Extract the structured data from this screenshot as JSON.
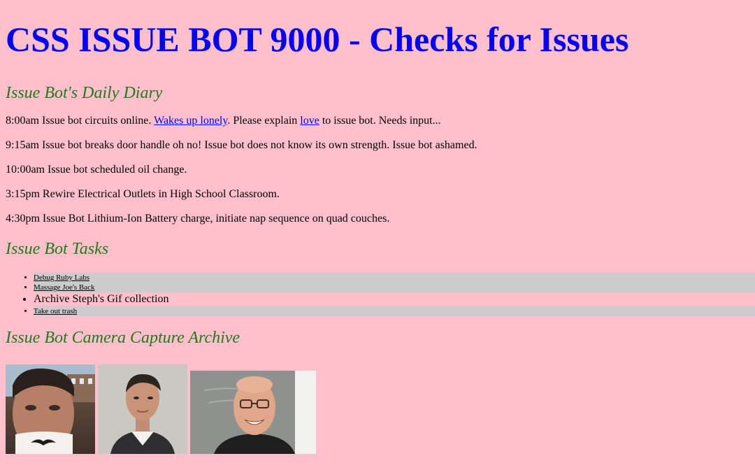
{
  "page": {
    "title": "CSS ISSUE BOT 9000 - Checks for Issues"
  },
  "diary": {
    "heading": "Issue Bot's Daily Diary",
    "entry1": {
      "text_a": "8:00am Issue bot circuits online. ",
      "link1": "Wakes up lonely",
      "text_b": ". Please explain ",
      "link2": "love",
      "text_c": " to issue bot. Needs input..."
    },
    "entry2": "9:15am Issue bot breaks door handle oh no! Issue bot does not know its own strength. Issue bot ashamed.",
    "entry3": "10:00am Issue bot scheduled oil change.",
    "entry4": "3:15pm Rewire Electrical Outlets in High School Classroom.",
    "entry5": "4:30pm Issue Bot Lithium-Ion Battery charge, initiate nap sequence on quad couches."
  },
  "tasks": {
    "heading": "Issue Bot Tasks",
    "items": [
      "Debug Ruby Labs",
      "Massage Joe's Back",
      "Archive Steph's Gif collection",
      "Take out trash"
    ]
  },
  "camera": {
    "heading": "Issue Bot Camera Capture Archive",
    "photos": [
      {
        "subject": "man with mustache mug"
      },
      {
        "subject": "man in sweater"
      },
      {
        "subject": "bald man with glasses"
      }
    ]
  },
  "colors": {
    "background": "#ffc0cb",
    "title": "#0000ff",
    "heading": "#1f7a1f",
    "task_highlight": "#cccccc",
    "link": "#0000ee"
  }
}
